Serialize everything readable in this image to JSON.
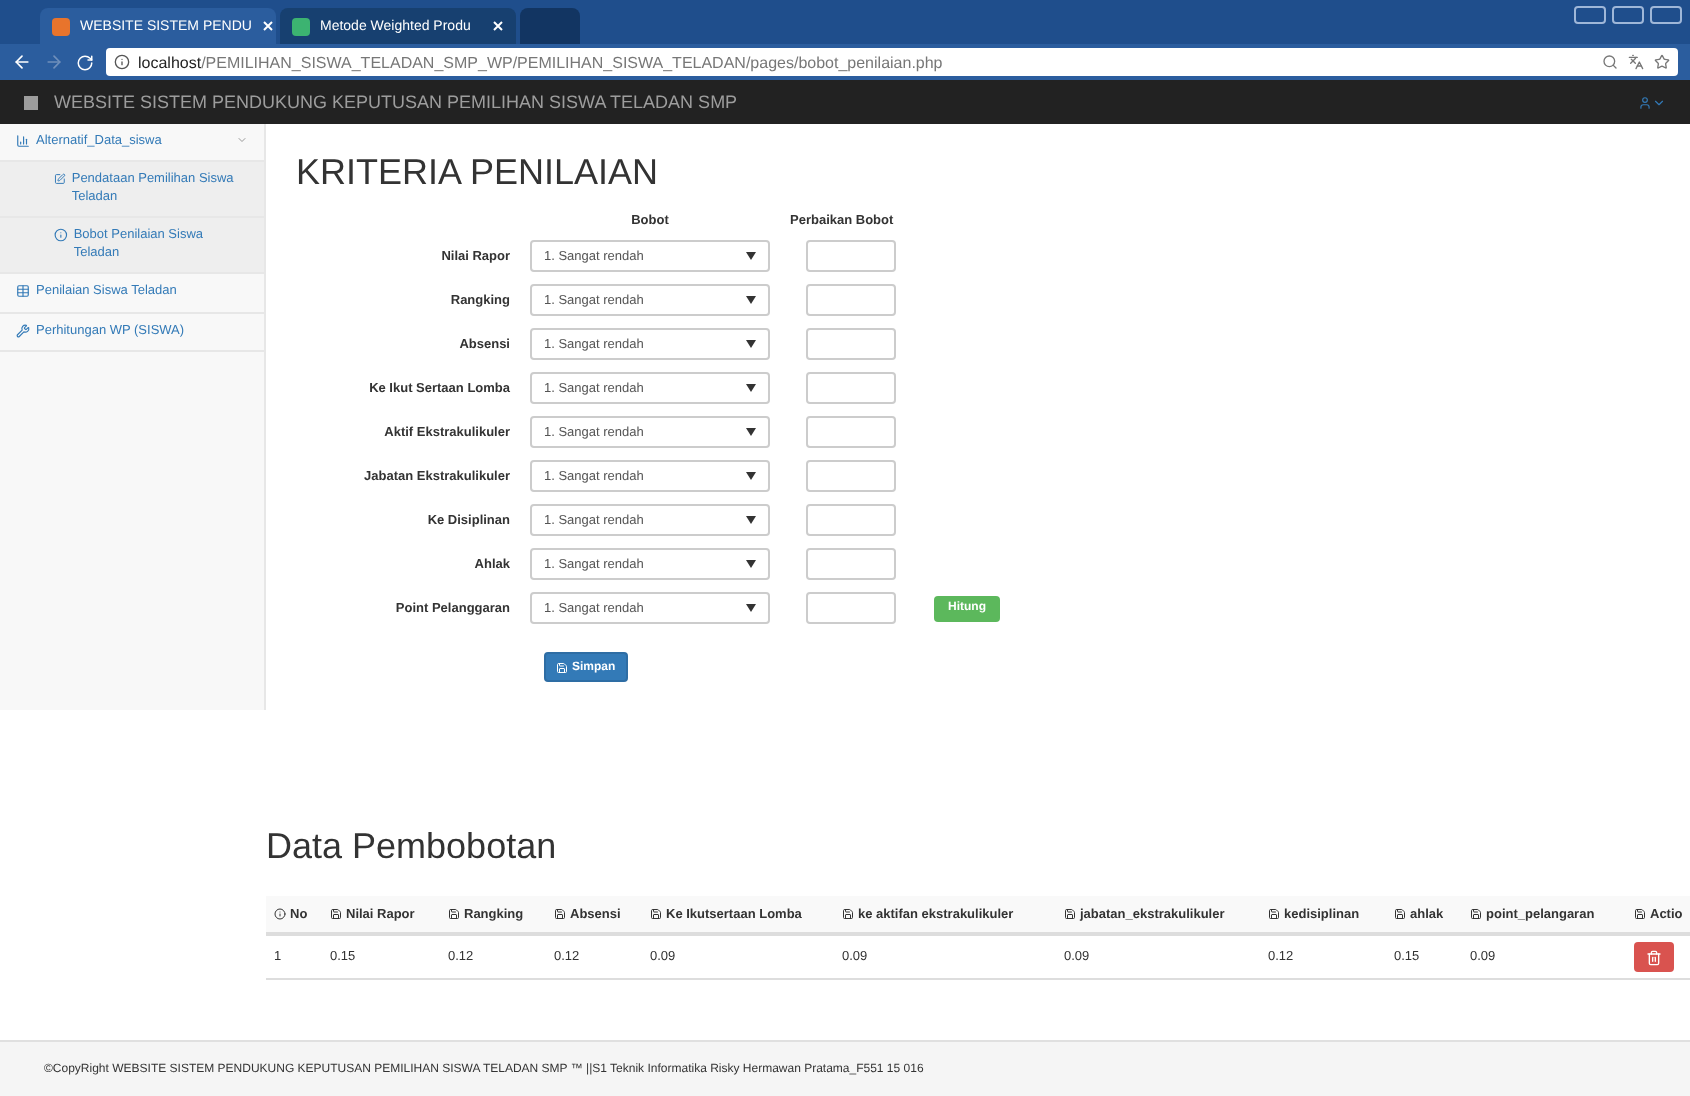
{
  "browser": {
    "tabs": [
      {
        "title": "WEBSITE SISTEM PENDU",
        "selected": true
      },
      {
        "title": "Metode Weighted Produ",
        "selected": false
      }
    ],
    "url_host": "localhost",
    "url_path": "/PEMILIHAN_SISWA_TELADAN_SMP_WP/PEMILIHAN_SISWA_TELADAN/pages/bobot_penilaian.php"
  },
  "navbar": {
    "title": "WEBSITE SISTEM PENDUKUNG KEPUTUSAN PEMILIHAN SISWA TELADAN SMP"
  },
  "sidebar": {
    "items": [
      {
        "label": "Alternatif_Data_siswa",
        "expanded": true,
        "children": [
          {
            "label": "Pendataan Pemilihan Siswa Teladan"
          },
          {
            "label": "Bobot Penilaian Siswa Teladan"
          }
        ]
      },
      {
        "label": "Penilaian Siswa Teladan"
      },
      {
        "label": "Perhitungan WP (SISWA)"
      }
    ]
  },
  "form": {
    "title": "KRITERIA PENILAIAN",
    "headers": [
      "Bobot",
      "Perbaikan Bobot"
    ],
    "rows": [
      {
        "label": "Nilai Rapor",
        "value": "1. Sangat rendah"
      },
      {
        "label": "Rangking",
        "value": "1. Sangat rendah"
      },
      {
        "label": "Absensi",
        "value": "1. Sangat rendah"
      },
      {
        "label": "Ke Ikut Sertaan Lomba",
        "value": "1. Sangat rendah"
      },
      {
        "label": "Aktif Ekstrakulikuler",
        "value": "1. Sangat rendah"
      },
      {
        "label": "Jabatan Ekstrakulikuler",
        "value": "1. Sangat rendah"
      },
      {
        "label": "Ke Disiplinan",
        "value": "1. Sangat rendah"
      },
      {
        "label": "Ahlak",
        "value": "1. Sangat rendah"
      },
      {
        "label": "Point Pelanggaran",
        "value": "1. Sangat rendah"
      }
    ],
    "calc_button": "Hitung",
    "save_button": "Simpan"
  },
  "data": {
    "title": "Data Pembobotan",
    "columns": [
      "No",
      "Nilai Rapor",
      "Rangking",
      "Absensi",
      "Ke Ikutsertaan Lomba",
      "ke aktifan ekstrakulikuler",
      "jabatan_ekstrakulikuler",
      "kedisiplinan",
      "ahlak",
      "point_pelangaran",
      "Actio"
    ],
    "rows": [
      [
        "1",
        "0.15",
        "0.12",
        "0.12",
        "0.09",
        "0.09",
        "0.09",
        "0.12",
        "0.15",
        "0.09"
      ]
    ]
  },
  "footer": "©CopyRight WEBSITE SISTEM PENDUKUNG KEPUTUSAN PEMILIHAN SISWA TELADAN SMP ™ ||S1 Teknik Informatika Risky Hermawan Pratama_F551 15 016"
}
